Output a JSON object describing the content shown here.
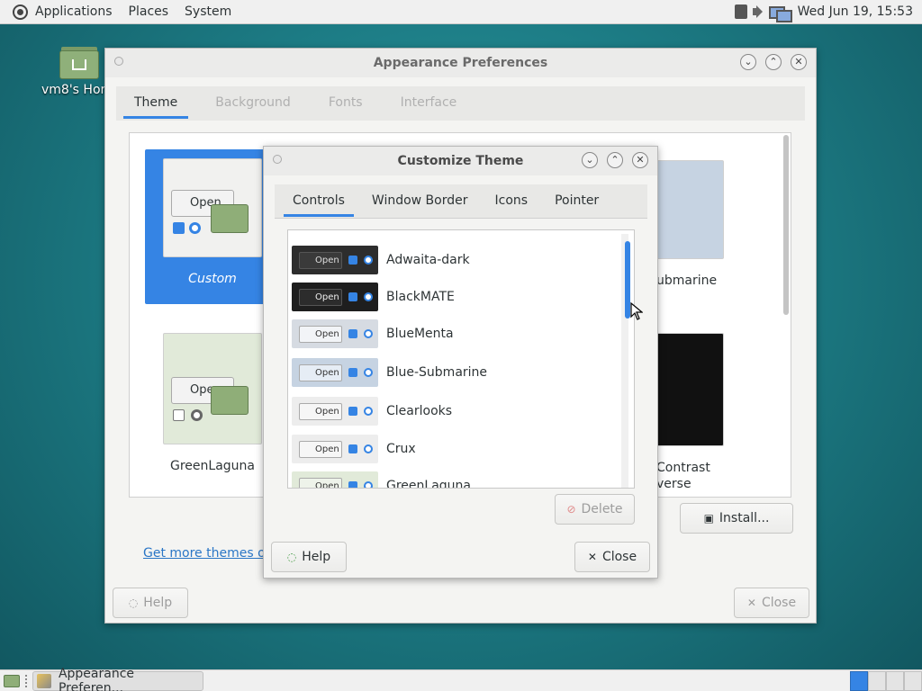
{
  "top_panel": {
    "menus": [
      "Applications",
      "Places",
      "System"
    ],
    "clock": "Wed Jun 19, 15:53"
  },
  "desktop": {
    "home_icon_label": "vm8's Hor"
  },
  "appearance": {
    "title": "Appearance Preferences",
    "tabs": [
      {
        "label": "Theme",
        "active": true
      },
      {
        "label": "Background",
        "active": false
      },
      {
        "label": "Fonts",
        "active": false
      },
      {
        "label": "Interface",
        "active": false
      }
    ],
    "themes": [
      {
        "name": "Custom",
        "selected": true
      },
      {
        "name": "GreenLaguna",
        "selected": false
      },
      {
        "name": "ubmarine",
        "selected": false
      },
      {
        "name": "Contrast",
        "line2": "verse",
        "selected": false
      }
    ],
    "get_more_themes": "Get more themes on",
    "install_label": "Install...",
    "help_label": "Help",
    "close_label": "Close"
  },
  "customize": {
    "title": "Customize Theme",
    "tabs": [
      {
        "label": "Controls",
        "active": true
      },
      {
        "label": "Window Border",
        "active": false
      },
      {
        "label": "Icons",
        "active": false
      },
      {
        "label": "Pointer",
        "active": false
      }
    ],
    "list": [
      {
        "name": "Adwaita-dark",
        "preview_bg": "#2d2d2d",
        "open_bg": "#3a3a3a",
        "open_fg": "#dddddd",
        "open_label": "Open"
      },
      {
        "name": "BlackMATE",
        "preview_bg": "#1e1e1e",
        "open_bg": "#2c2c2c",
        "open_fg": "#eeeeee",
        "open_label": "Open"
      },
      {
        "name": "BlueMenta",
        "preview_bg": "#d6dbe2",
        "open_bg": "#f2f4f7",
        "open_fg": "#333333",
        "open_label": "Open"
      },
      {
        "name": "Blue-Submarine",
        "preview_bg": "#c6d3e2",
        "open_bg": "#e6edf5",
        "open_fg": "#333333",
        "open_label": "Open"
      },
      {
        "name": "Clearlooks",
        "preview_bg": "#ededed",
        "open_bg": "#f6f6f6",
        "open_fg": "#333333",
        "open_label": "Open"
      },
      {
        "name": "Crux",
        "preview_bg": "#ededed",
        "open_bg": "#f6f6f6",
        "open_fg": "#333333",
        "open_label": "Open"
      },
      {
        "name": "GreenLaguna",
        "preview_bg": "#e1ead9",
        "open_bg": "#eef3ea",
        "open_fg": "#333333",
        "open_label": "Open"
      }
    ],
    "delete_label": "Delete",
    "help_label": "Help",
    "close_label": "Close"
  },
  "taskbar": {
    "task_label": "Appearance Preferen..."
  },
  "colors": {
    "accent": "#3584e4",
    "desktop": "#1d7d86"
  }
}
